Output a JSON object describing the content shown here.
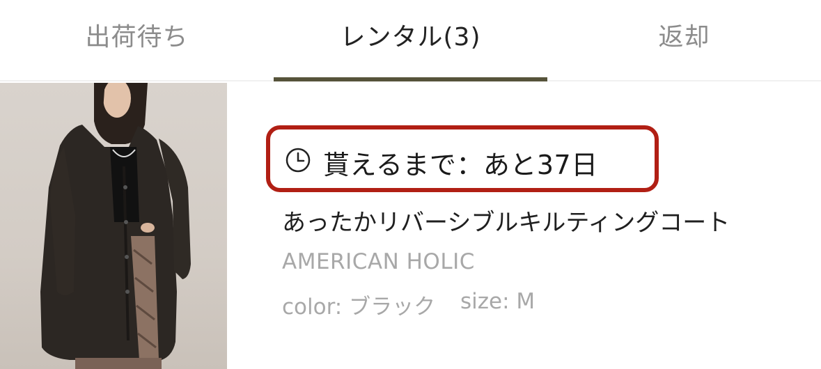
{
  "tabs": [
    {
      "label": "出荷待ち",
      "active": false
    },
    {
      "label": "レンタル(3)",
      "active": true
    },
    {
      "label": "返却",
      "active": false
    }
  ],
  "accent_color": "#56533a",
  "highlight_color": "#b11f14",
  "item": {
    "image_icon": "product-photo-coat",
    "countdown_icon": "clock-icon",
    "countdown": "貰えるまで：あと37日",
    "name": "あったかリバーシブルキルティングコート",
    "brand": "AMERICAN HOLIC",
    "color": "color: ブラック",
    "size": "size: M"
  }
}
